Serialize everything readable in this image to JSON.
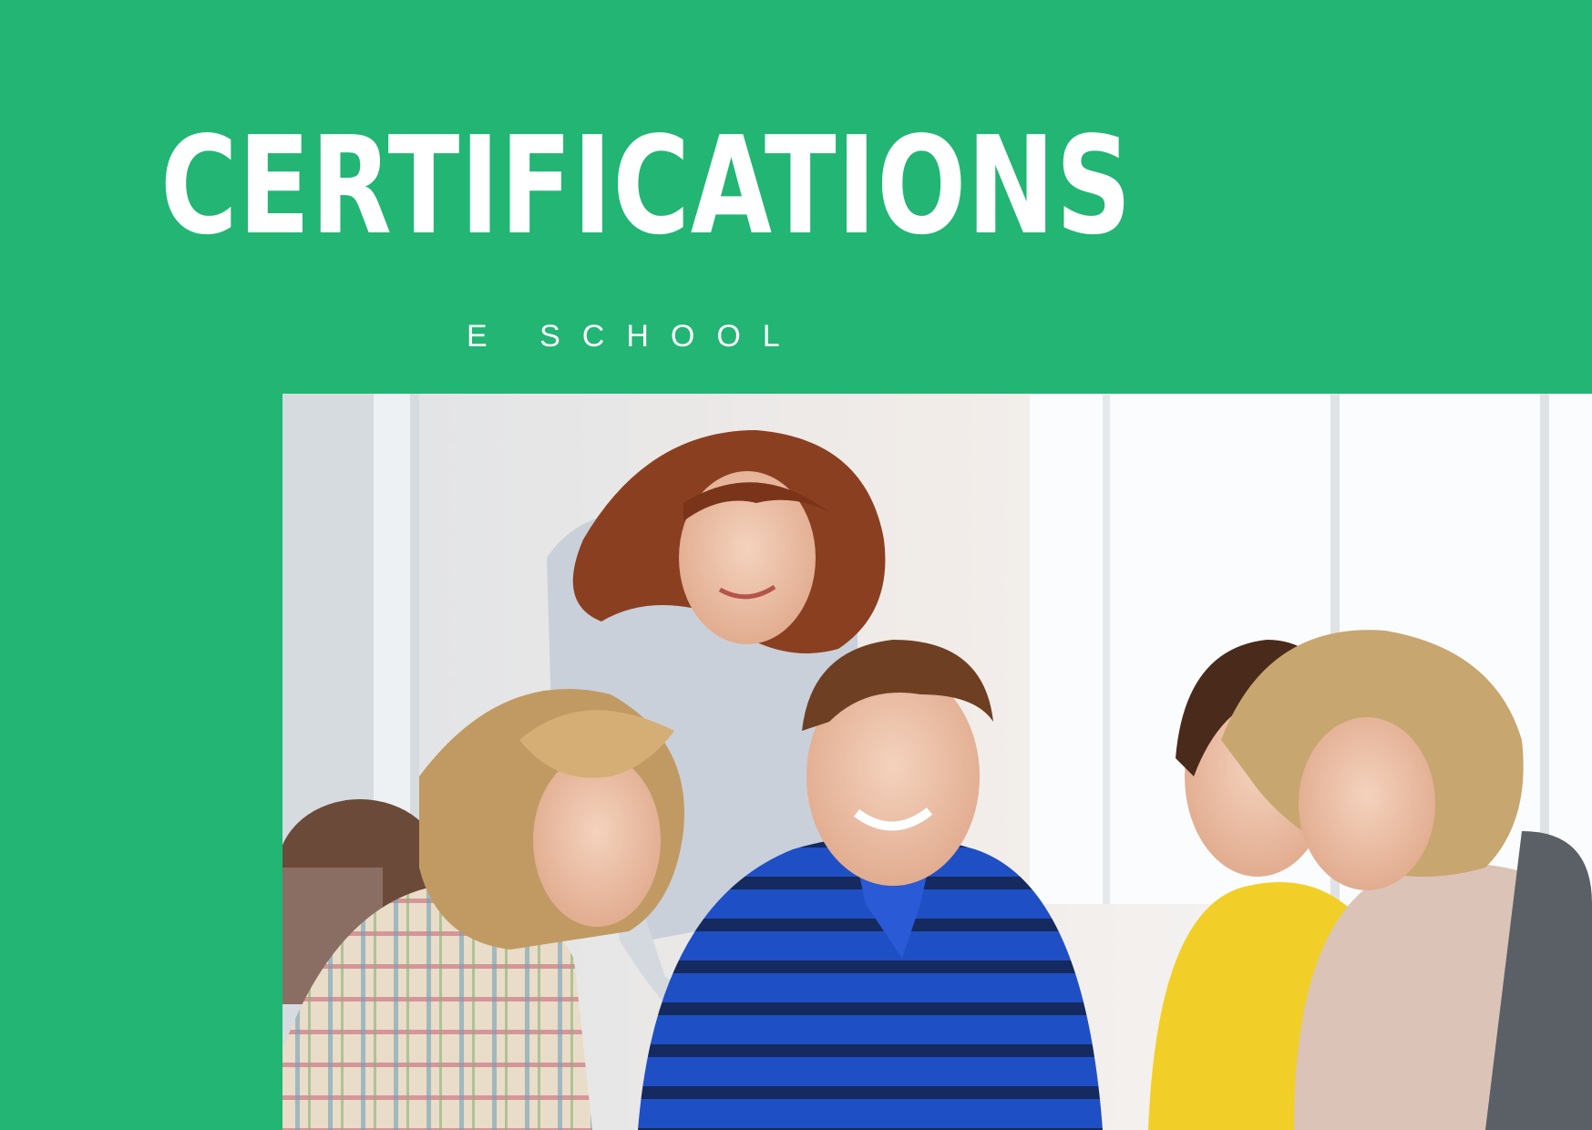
{
  "header": {
    "title": "CERTIFICATIONS",
    "subtitle": "E SCHOOL"
  },
  "colors": {
    "background": "#22b573",
    "text": "#ffffff"
  },
  "photo": {
    "icon": "classroom-photo"
  }
}
